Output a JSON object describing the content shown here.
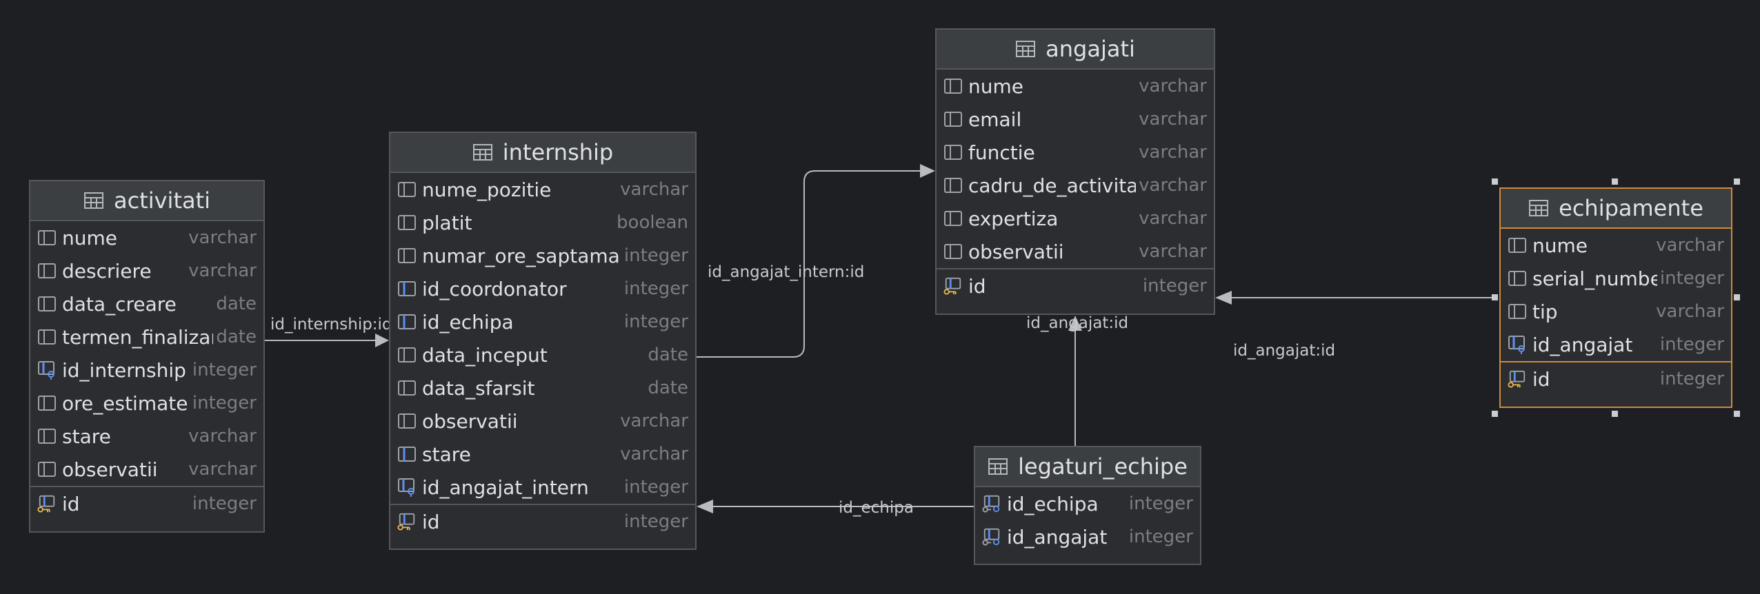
{
  "tables": {
    "activitati": {
      "title": "activitati",
      "fields": [
        {
          "name": "nume",
          "type": "varchar",
          "kind": "column"
        },
        {
          "name": "descriere",
          "type": "varchar",
          "kind": "column"
        },
        {
          "name": "data_creare",
          "type": "date",
          "kind": "column"
        },
        {
          "name": "termen_finalizare",
          "type": "date",
          "kind": "column"
        },
        {
          "name": "id_internship",
          "type": "integer",
          "kind": "fk"
        },
        {
          "name": "ore_estimate",
          "type": "integer",
          "kind": "column"
        },
        {
          "name": "stare",
          "type": "varchar",
          "kind": "column"
        },
        {
          "name": "observatii",
          "type": "varchar",
          "kind": "column"
        }
      ],
      "key": {
        "name": "id",
        "type": "integer"
      }
    },
    "internship": {
      "title": "internship",
      "fields": [
        {
          "name": "nume_pozitie",
          "type": "varchar",
          "kind": "column"
        },
        {
          "name": "platit",
          "type": "boolean",
          "kind": "column"
        },
        {
          "name": "numar_ore_saptamanale",
          "type": "integer",
          "kind": "column"
        },
        {
          "name": "id_coordonator",
          "type": "integer",
          "kind": "column-blue"
        },
        {
          "name": "id_echipa",
          "type": "integer",
          "kind": "column-blue"
        },
        {
          "name": "data_inceput",
          "type": "date",
          "kind": "column"
        },
        {
          "name": "data_sfarsit",
          "type": "date",
          "kind": "column"
        },
        {
          "name": "observatii",
          "type": "varchar",
          "kind": "column"
        },
        {
          "name": "stare",
          "type": "varchar",
          "kind": "column-blue"
        },
        {
          "name": "id_angajat_intern",
          "type": "integer",
          "kind": "fk"
        }
      ],
      "key": {
        "name": "id",
        "type": "integer"
      }
    },
    "angajati": {
      "title": "angajati",
      "fields": [
        {
          "name": "nume",
          "type": "varchar",
          "kind": "column"
        },
        {
          "name": "email",
          "type": "varchar",
          "kind": "column"
        },
        {
          "name": "functie",
          "type": "varchar",
          "kind": "column"
        },
        {
          "name": "cadru_de_activitate",
          "type": "varchar",
          "kind": "column"
        },
        {
          "name": "expertiza",
          "type": "varchar",
          "kind": "column"
        },
        {
          "name": "observatii",
          "type": "varchar",
          "kind": "column"
        }
      ],
      "key": {
        "name": "id",
        "type": "integer"
      }
    },
    "echipamente": {
      "title": "echipamente",
      "fields": [
        {
          "name": "nume",
          "type": "varchar",
          "kind": "column"
        },
        {
          "name": "serial_number",
          "type": "integer",
          "kind": "column"
        },
        {
          "name": "tip",
          "type": "varchar",
          "kind": "column"
        },
        {
          "name": "id_angajat",
          "type": "integer",
          "kind": "fk"
        }
      ],
      "key": {
        "name": "id",
        "type": "integer"
      }
    },
    "legaturi_echipe": {
      "title": "legaturi_echipe",
      "fields": [
        {
          "name": "id_echipa",
          "type": "integer",
          "kind": "pkfk"
        },
        {
          "name": "id_angajat",
          "type": "integer",
          "kind": "pkfk"
        }
      ]
    }
  },
  "relations": {
    "activitati_internship": "id_internship:id",
    "internship_angajati": "id_angajat_intern:id",
    "legaturi_angajati": "id_angajat:id",
    "echipamente_angajati": "id_angajat:id",
    "legaturi_internship": "id_echipa"
  },
  "colors": {
    "background": "#1e1f22",
    "table_bg": "#2b2d30",
    "header_bg": "#3c3f41",
    "border": "#55575c",
    "selection": "#d18a3a",
    "key_icon": "#e8b64a",
    "fk_icon": "#5f8ff0",
    "link_line": "#b8bbc0"
  },
  "icons": {
    "table": "table-grid-icon",
    "column": "column-icon",
    "primary_key": "primary-key-icon",
    "foreign_key": "foreign-key-icon"
  }
}
